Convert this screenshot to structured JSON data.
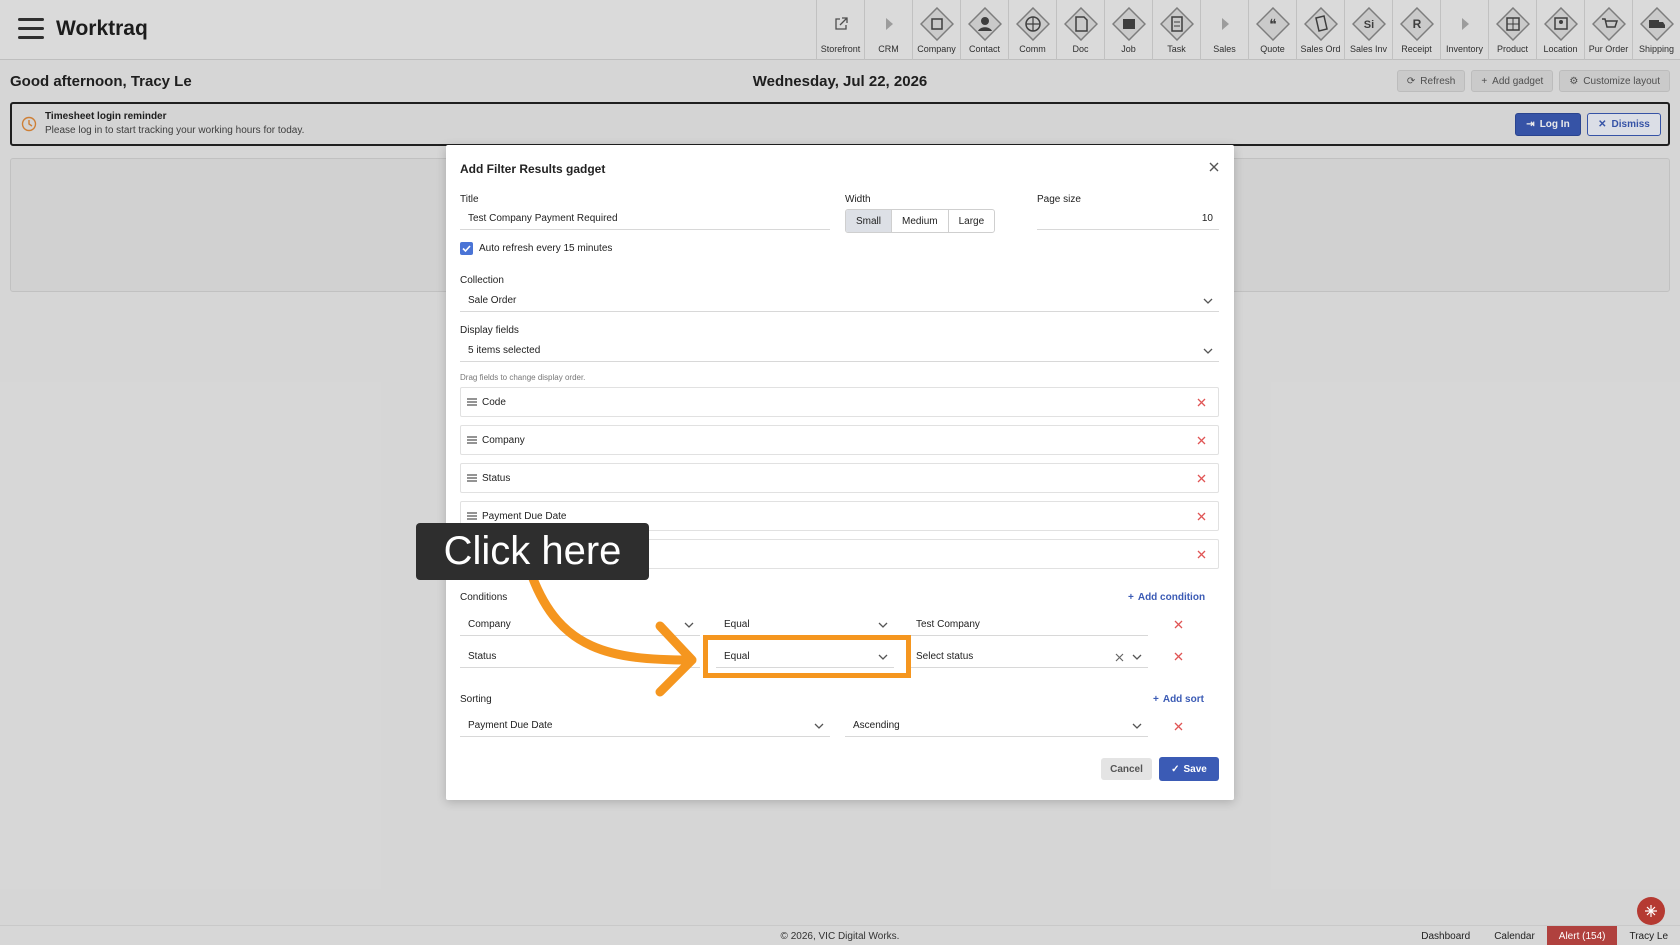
{
  "app": {
    "title": "Worktraq"
  },
  "modules": [
    {
      "label": "Storefront",
      "icon": "external-link-icon"
    },
    {
      "label": "CRM",
      "icon": "caret-right-icon"
    },
    {
      "label": "Company",
      "icon": "company-icon"
    },
    {
      "label": "Contact",
      "icon": "contact-icon"
    },
    {
      "label": "Comm",
      "icon": "globe-icon"
    },
    {
      "label": "Doc",
      "icon": "document-icon"
    },
    {
      "label": "Job",
      "icon": "job-icon"
    },
    {
      "label": "Task",
      "icon": "clipboard-icon"
    },
    {
      "label": "Sales",
      "icon": "caret-right-icon"
    },
    {
      "label": "Quote",
      "icon": "quote-icon"
    },
    {
      "label": "Sales Ord",
      "icon": "sales-order-icon"
    },
    {
      "label": "Sales Inv",
      "icon": "sales-invoice-icon",
      "glyph": "Si"
    },
    {
      "label": "Receipt",
      "icon": "receipt-icon",
      "glyph": "R"
    },
    {
      "label": "Inventory",
      "icon": "caret-right-icon"
    },
    {
      "label": "Product",
      "icon": "product-icon"
    },
    {
      "label": "Location",
      "icon": "location-icon"
    },
    {
      "label": "Pur Order",
      "icon": "cart-icon"
    },
    {
      "label": "Shipping",
      "icon": "truck-icon"
    }
  ],
  "header": {
    "greeting": "Good afternoon, Tracy Le",
    "date": "Wednesday, Jul 22, 2026",
    "refresh_label": "Refresh",
    "add_gadget_label": "Add gadget",
    "customize_label": "Customize layout"
  },
  "reminder": {
    "title": "Timesheet login reminder",
    "text": "Please log in to start tracking your working hours for today.",
    "login_label": "Log In",
    "dismiss_label": "Dismiss"
  },
  "modal": {
    "title": "Add Filter Results gadget",
    "title_label": "Title",
    "title_value": "Test Company Payment Required",
    "width_label": "Width",
    "width_options": [
      "Small",
      "Medium",
      "Large"
    ],
    "width_selected": "Small",
    "page_size_label": "Page size",
    "page_size_value": "10",
    "auto_refresh_label": "Auto refresh every 15 minutes",
    "auto_refresh_checked": true,
    "collection_label": "Collection",
    "collection_value": "Sale Order",
    "display_fields_label": "Display fields",
    "display_fields_value": "5 items selected",
    "drag_hint": "Drag fields to change display order.",
    "display_items": [
      "Code",
      "Company",
      "Status",
      "Payment Due Date",
      ""
    ],
    "conditions_label": "Conditions",
    "add_condition_label": "Add condition",
    "conditions": [
      {
        "field": "Company",
        "operator": "Equal",
        "value": "Test Company"
      },
      {
        "field": "Status",
        "operator": "Equal",
        "value": "Select status"
      }
    ],
    "sorting_label": "Sorting",
    "add_sort_label": "Add sort",
    "sort": {
      "field": "Payment Due Date",
      "direction": "Ascending"
    },
    "cancel_label": "Cancel",
    "save_label": "Save"
  },
  "annotation": {
    "text": "Click here",
    "color": "#f5961f"
  },
  "footer": {
    "copyright": "© 2026, VIC Digital Works.",
    "nav": [
      "Dashboard",
      "Calendar",
      "Alert (154)",
      "Tracy Le"
    ]
  },
  "colors": {
    "primary": "#3b5bb5",
    "danger": "#e05555",
    "alert_bg": "#b0413e",
    "highlight": "#f5961f"
  }
}
